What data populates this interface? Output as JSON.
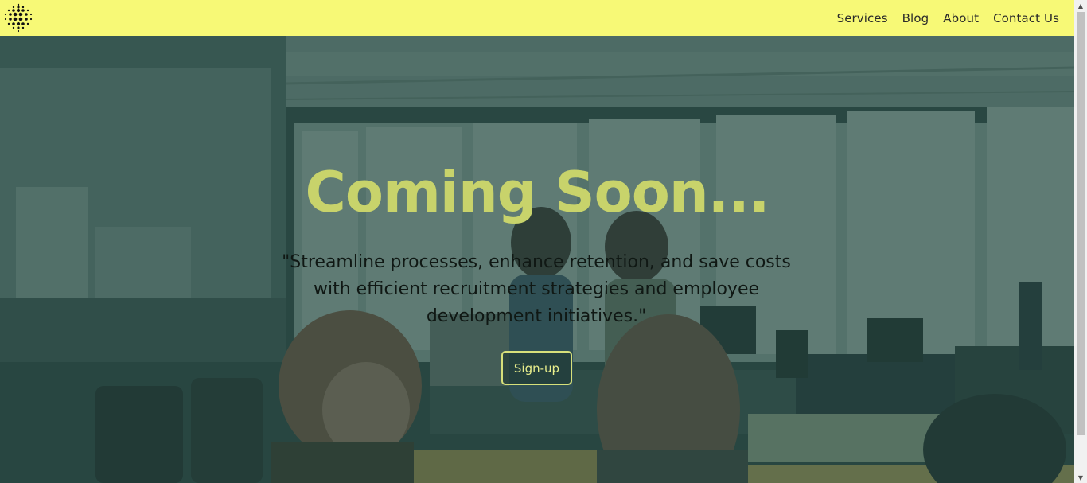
{
  "nav": {
    "items": [
      {
        "label": "Services"
      },
      {
        "label": "Blog"
      },
      {
        "label": "About"
      },
      {
        "label": "Contact Us"
      }
    ]
  },
  "hero": {
    "title": "Coming Soon...",
    "subtitle": "\"Streamline processes, enhance retention, and save costs with efficient recruitment strategies and employee development initiatives.\"",
    "cta_label": "Sign-up"
  },
  "colors": {
    "header_bg": "#f7f976",
    "title": "#c8d36b",
    "overlay": "#2f4b46",
    "cta_border": "#d7e07a"
  },
  "icons": {
    "logo": "dot-grid-logo-icon",
    "scroll_up": "scroll-up-arrow-icon",
    "scroll_down": "scroll-down-arrow-icon"
  }
}
